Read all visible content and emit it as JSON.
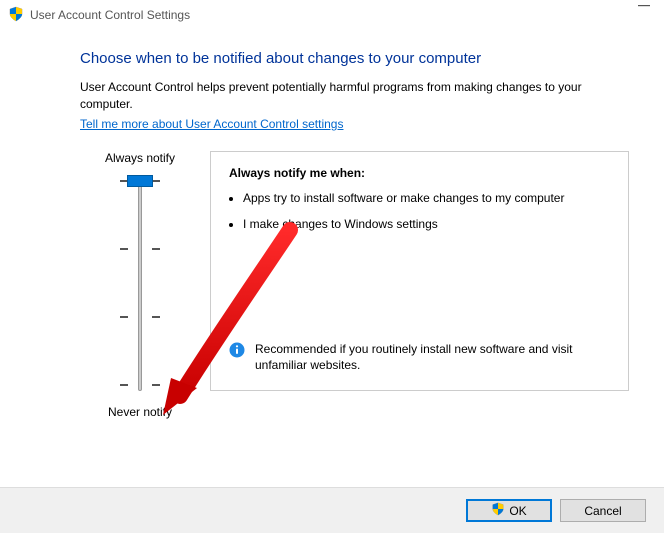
{
  "window": {
    "title": "User Account Control Settings"
  },
  "header": {
    "heading": "Choose when to be notified about changes to your computer",
    "description": "User Account Control helps prevent potentially harmful programs from making changes to your computer.",
    "link_text": "Tell me more about User Account Control settings"
  },
  "slider": {
    "top_label": "Always notify",
    "bottom_label": "Never notify",
    "levels": 4,
    "current_level_index": 0
  },
  "info_panel": {
    "title": "Always notify me when:",
    "bullets": [
      "Apps try to install software or make changes to my computer",
      "I make changes to Windows settings"
    ],
    "recommendation": "Recommended if you routinely install new software and visit unfamiliar websites."
  },
  "buttons": {
    "ok": "OK",
    "cancel": "Cancel"
  }
}
